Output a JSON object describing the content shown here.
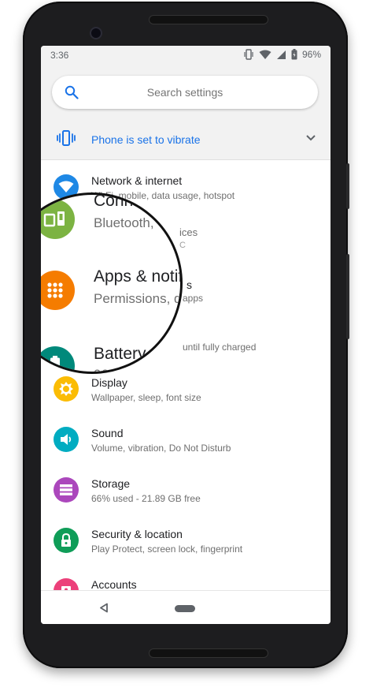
{
  "status_bar": {
    "time": "3:36",
    "battery": "96%",
    "icons": [
      "vibrate-icon",
      "wifi-icon",
      "signal-icon",
      "battery-icon"
    ]
  },
  "search": {
    "placeholder": "Search settings"
  },
  "suggestion": {
    "text": "Phone is set to vibrate",
    "icon": "vibrate-icon",
    "color": "#1a73e8"
  },
  "items": [
    {
      "title": "Network & internet",
      "subtitle": "Wi-Fi, mobile, data usage, hotspot",
      "icon": "wifi-icon",
      "color": "#1e88e5"
    },
    {
      "title": "Connected devices",
      "subtitle": "Bluetooth, devices",
      "icon": "devices-icon",
      "color": "#7cb342"
    },
    {
      "title": "Apps & notifications",
      "subtitle": "Permissions, default apps",
      "icon": "apps-icon",
      "color": "#f57c00"
    },
    {
      "title": "Battery",
      "subtitle": "96% - until fully charged",
      "icon": "battery-icon",
      "color": "#00897b"
    },
    {
      "title": "Display",
      "subtitle": "Wallpaper, sleep, font size",
      "icon": "display-icon",
      "color": "#fbbc04"
    },
    {
      "title": "Sound",
      "subtitle": "Volume, vibration, Do Not Disturb",
      "icon": "sound-icon",
      "color": "#00acc1"
    },
    {
      "title": "Storage",
      "subtitle": "66% used - 21.89 GB free",
      "icon": "storage-icon",
      "color": "#ab47bc"
    },
    {
      "title": "Security & location",
      "subtitle": "Play Protect, screen lock, fingerprint",
      "icon": "lock-icon",
      "color": "#0f9d58"
    },
    {
      "title": "Accounts",
      "subtitle": "",
      "icon": "accounts-icon",
      "color": "#ec407a"
    }
  ],
  "lens": {
    "rows": [
      {
        "title": "Conne",
        "subtitle": "Bluetooth, "
      },
      {
        "title": "Apps & notifi",
        "subtitle": "Permissions, d"
      },
      {
        "title": "Battery",
        "subtitle": "96%"
      }
    ]
  },
  "partial_text": {
    "connected_sub_tail": "ices",
    "connected_sub_small": "C",
    "apps_title_tail": "s",
    "apps_sub_tail": "apps",
    "battery_sub_tail": "until fully charged"
  }
}
